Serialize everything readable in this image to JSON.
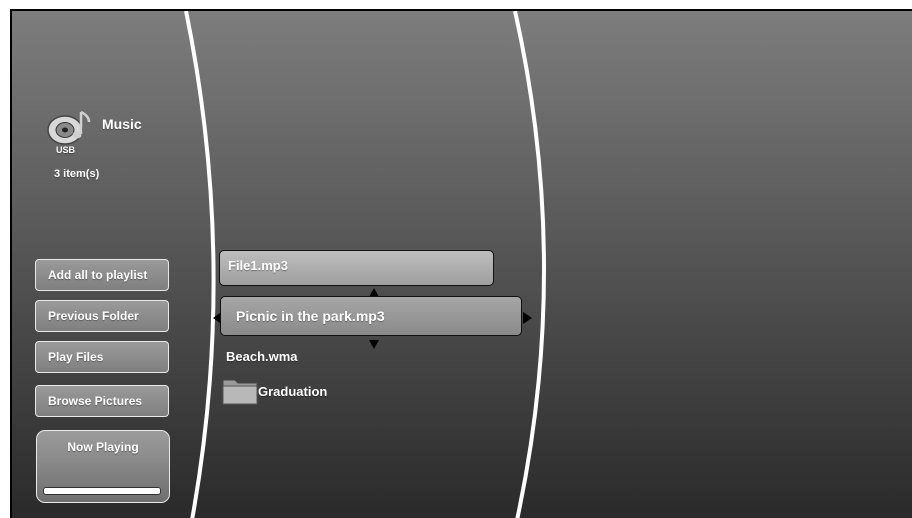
{
  "source": {
    "title": "Music",
    "device": "USB",
    "item_count": "3 item(s)",
    "icon": "music-note-disc-icon"
  },
  "sidebar": {
    "buttons": [
      {
        "label": "Add all to playlist"
      },
      {
        "label": "Previous Folder"
      },
      {
        "label": "Play Files"
      },
      {
        "label": "Browse Pictures"
      }
    ],
    "now_playing": {
      "label": "Now Playing",
      "progress": 0
    }
  },
  "files": [
    {
      "name": "File1.mp3",
      "type": "audio"
    },
    {
      "name": "Picnic in the park.mp3",
      "type": "audio",
      "selected": true
    },
    {
      "name": "Beach.wma",
      "type": "audio"
    },
    {
      "name": "Graduation",
      "type": "folder",
      "icon": "folder-icon"
    }
  ],
  "colors": {
    "background_top": "#7d7d7d",
    "background_bottom": "#2a2a2a",
    "divider": "#ffffff",
    "text": "#ffffff"
  }
}
